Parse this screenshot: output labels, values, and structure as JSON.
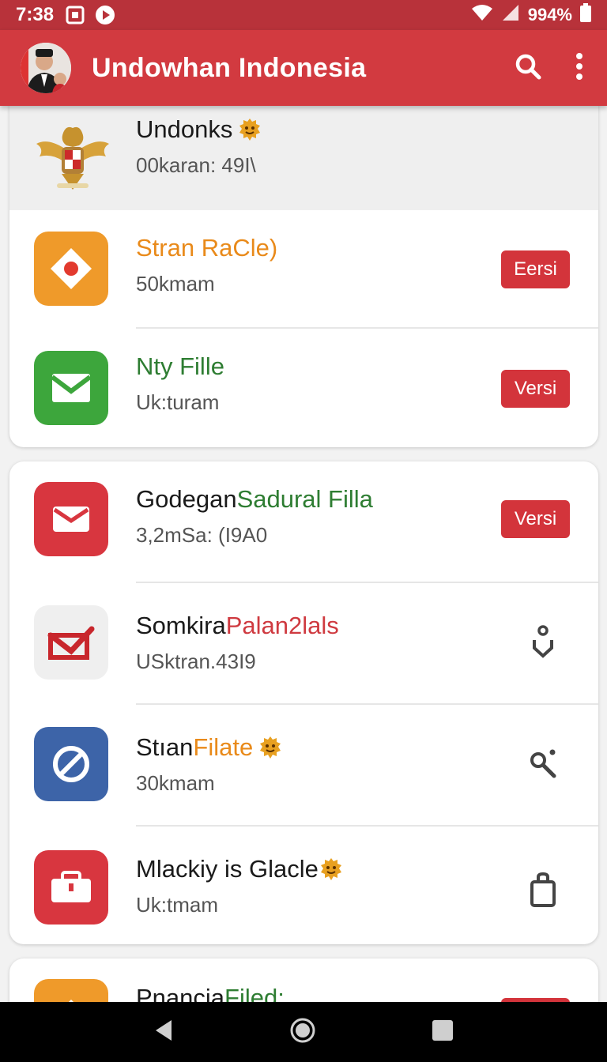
{
  "status_bar": {
    "time": "7:38",
    "battery": "994%"
  },
  "app_bar": {
    "title": "Undowhan Indonesia"
  },
  "header_item": {
    "title": "Undonks",
    "subtitle": "00karan: 49I\\"
  },
  "card1": [
    {
      "title": "Stran RaCle)",
      "subtitle": "50kmam",
      "action": "Eersi"
    },
    {
      "title": "Nty Fille",
      "subtitle": "Uk:turam",
      "action": "Versi"
    }
  ],
  "card2": [
    {
      "title_a": "Godegan ",
      "title_b": "Sadural Filla",
      "subtitle": "3,2mSa: (I9A0",
      "action": "Versi"
    },
    {
      "title_a": "Somkira ",
      "title_b": "Palan2lals",
      "subtitle": "USktran.43I9"
    },
    {
      "title_a": "Stıan ",
      "title_b": "Filate",
      "subtitle": "30kmam"
    },
    {
      "title_a": "Mlackiy is Glacle",
      "subtitle": "Uk:tmam"
    }
  ],
  "card3": {
    "title_a": "Pnancia ",
    "title_b": "Filed:"
  },
  "colors": {
    "app_bar": "#d23a40",
    "status_bar": "#b8323a",
    "orange": "#e98a1a",
    "green": "#2e7d32",
    "red": "#cf3a40",
    "blue": "#3d64a8"
  }
}
